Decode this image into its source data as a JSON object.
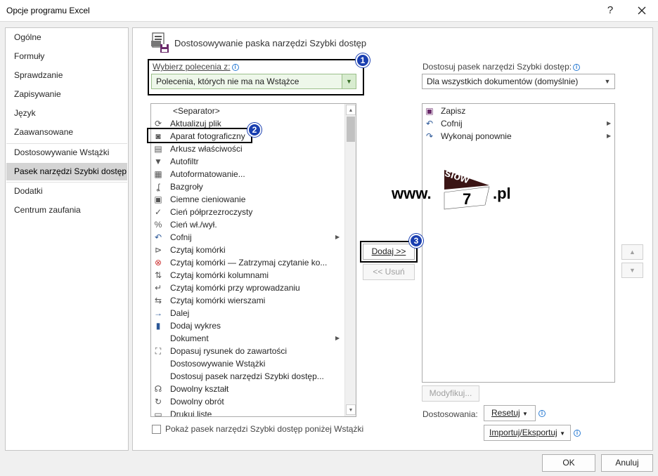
{
  "window": {
    "title": "Opcje programu Excel",
    "help_glyph": "?",
    "close_icon": "close-icon"
  },
  "sidebar": {
    "items": [
      {
        "label": "Ogólne"
      },
      {
        "label": "Formuły"
      },
      {
        "label": "Sprawdzanie"
      },
      {
        "label": "Zapisywanie"
      },
      {
        "label": "Język"
      },
      {
        "label": "Zaawansowane"
      },
      {
        "label": "Dostosowywanie Wstążki"
      },
      {
        "label": "Pasek narzędzi Szybki dostęp",
        "selected": true
      },
      {
        "label": "Dodatki"
      },
      {
        "label": "Centrum zaufania"
      }
    ]
  },
  "main": {
    "section_title": "Dostosowywanie paska narzędzi Szybki dostęp",
    "choose_label": "Wybierz polecenia z:",
    "choose_value": "Polecenia, których nie ma na Wstążce",
    "target_label": "Dostosuj pasek narzędzi Szybki dostęp:",
    "target_value": "Dla wszystkich dokumentów (domyślnie)",
    "commands": [
      {
        "label": "<Separator>",
        "icon": "none"
      },
      {
        "label": "Aktualizuj plik",
        "icon": "refresh-file-icon"
      },
      {
        "label": "Aparat fotograficzny",
        "icon": "camera-icon"
      },
      {
        "label": "Arkusz właściwości",
        "icon": "property-sheet-icon"
      },
      {
        "label": "Autofiltr",
        "icon": "filter-icon"
      },
      {
        "label": "Autoformatowanie...",
        "icon": "autoformat-icon"
      },
      {
        "label": "Bazgroły",
        "icon": "scribble-icon"
      },
      {
        "label": "Ciemne cieniowanie",
        "icon": "dark-shading-icon"
      },
      {
        "label": "Cień półprzezroczysty",
        "icon": "check-icon"
      },
      {
        "label": "Cień wł./wył.",
        "icon": "shadow-toggle-icon"
      },
      {
        "label": "Cofnij",
        "icon": "undo-icon",
        "submenu": true
      },
      {
        "label": "Czytaj komórki",
        "icon": "speak-cells-icon"
      },
      {
        "label": "Czytaj komórki — Zatrzymaj czytanie ko...",
        "icon": "stop-speaking-icon"
      },
      {
        "label": "Czytaj komórki kolumnami",
        "icon": "speak-columns-icon"
      },
      {
        "label": "Czytaj komórki przy wprowadzaniu",
        "icon": "speak-enter-icon"
      },
      {
        "label": "Czytaj komórki wierszami",
        "icon": "speak-rows-icon"
      },
      {
        "label": "Dalej",
        "icon": "arrow-right-icon"
      },
      {
        "label": "Dodaj wykres",
        "icon": "chart-icon"
      },
      {
        "label": "Dokument",
        "icon": "none",
        "submenu": true
      },
      {
        "label": "Dopasuj rysunek do zawartości",
        "icon": "fit-picture-icon"
      },
      {
        "label": "Dostosowywanie Wstążki",
        "icon": "none"
      },
      {
        "label": "Dostosuj pasek narzędzi Szybki dostęp...",
        "icon": "none"
      },
      {
        "label": "Dowolny kształt",
        "icon": "freeform-icon"
      },
      {
        "label": "Dowolny obrót",
        "icon": "rotate-icon"
      },
      {
        "label": "Drukuj listę",
        "icon": "print-list-icon"
      }
    ],
    "add_button": "Dodaj >>",
    "remove_button": "<< Usuń",
    "toolbar_items": [
      {
        "label": "Zapisz",
        "icon": "save-icon"
      },
      {
        "label": "Cofnij",
        "icon": "undo-icon",
        "submenu": true
      },
      {
        "label": "Wykonaj ponownie",
        "icon": "redo-icon",
        "submenu": true
      }
    ],
    "modify_button": "Modyfikuj...",
    "customizations_label": "Dostosowania:",
    "reset_button": "Resetuj",
    "import_export_button": "Importuj/Eksportuj",
    "show_below_label": "Pokaż pasek narzędzi Szybki dostęp poniżej Wstążki",
    "show_below_checked": false
  },
  "annotations": {
    "badges": [
      "1",
      "2",
      "3"
    ],
    "watermark_prefix": "www.",
    "watermark_logo_top": "slow",
    "watermark_logo_num": "7",
    "watermark_suffix": ".pl"
  },
  "footer": {
    "ok_button": "OK",
    "cancel_button": "Anuluj"
  },
  "colors": {
    "accent_blue": "#2b7cd3",
    "badge_blue": "#1a3fb0",
    "selected_sidebar": "#d4d4d4",
    "logo_dark": "#3a1414"
  }
}
